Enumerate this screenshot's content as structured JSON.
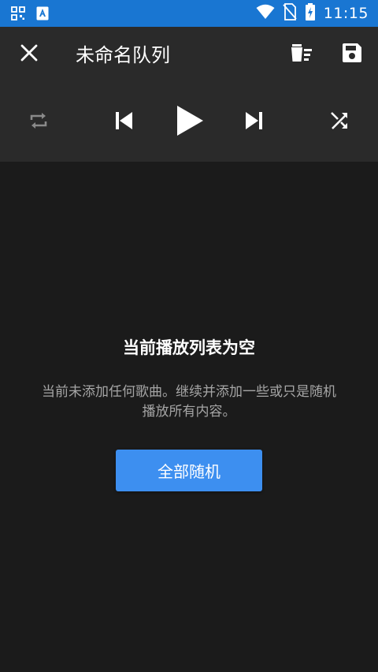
{
  "status_bar": {
    "time": "11:15",
    "background_color": "#1976d2",
    "left_icons": [
      "qr-icon",
      "accessibility-icon"
    ],
    "right_icons": [
      "wifi-icon",
      "no-sim-icon",
      "battery-charging-icon"
    ]
  },
  "header": {
    "title": "未命名队列",
    "background_color": "#2a2a2a",
    "close_icon": "close-icon",
    "clear_icon": "clear-queue-icon",
    "save_icon": "save-icon"
  },
  "controls": {
    "repeat_icon": "repeat-icon",
    "previous_icon": "skip-previous-icon",
    "play_icon": "play-icon",
    "next_icon": "skip-next-icon",
    "shuffle_icon": "shuffle-icon"
  },
  "empty_state": {
    "title": "当前播放列表为空",
    "description": "当前未添加任何歌曲。继续并添加一些或只是随机播放所有内容。",
    "button_label": "全部随机",
    "button_color": "#3d8ff0"
  }
}
